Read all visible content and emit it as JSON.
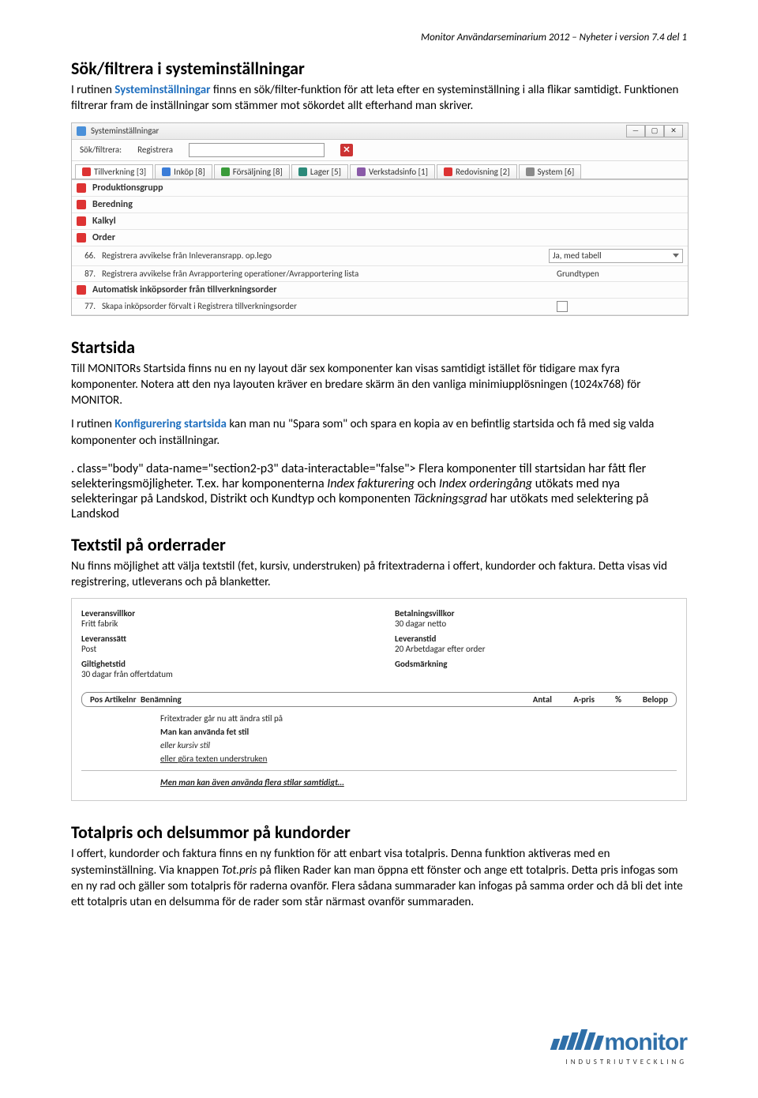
{
  "header": "Monitor Användarseminarium 2012 – Nyheter i version 7.4 del 1",
  "sec1": {
    "title": "Sök/filtrera i systeminställningar",
    "para": "I rutinen Systeminställningar finns en sök/filter-funktion för att leta efter en systeminställning i alla flikar samtidigt. Funktionen filtrerar fram de inställningar som stämmer mot sökordet allt efterhand man skriver.",
    "link_word": "Systeminställningar"
  },
  "ss1": {
    "title": "Systeminställningar",
    "toolbar": {
      "label1": "Sök/filtrera:",
      "label2": "Registrera"
    },
    "tabs": [
      {
        "label": "Tillverkning [3]",
        "cls": "red"
      },
      {
        "label": "Inköp [8]",
        "cls": "blue"
      },
      {
        "label": "Försäljning [8]",
        "cls": "green"
      },
      {
        "label": "Lager [5]",
        "cls": "teal"
      },
      {
        "label": "Verkstadsinfo [1]",
        "cls": "nv"
      },
      {
        "label": "Redovisning [2]",
        "cls": "red"
      },
      {
        "label": "System [6]",
        "cls": "sys"
      }
    ],
    "groups": [
      "Produktionsgrupp",
      "Beredning",
      "Kalkyl",
      "Order"
    ],
    "rows": [
      {
        "num": "66.",
        "label": "Registrera avvikelse från Inleveransrapp. op.lego",
        "value": "Ja, med tabell",
        "type": "select"
      },
      {
        "num": "87.",
        "label": "Registrera avvikelse från Avrapportering operationer/Avrapportering lista",
        "value": "Grundtypen",
        "type": "text"
      }
    ],
    "group2": "Automatisk inköpsorder från tillverkningsorder",
    "row77": {
      "num": "77.",
      "label": "Skapa inköpsorder förvalt i Registrera tillverkningsorder"
    }
  },
  "sec2": {
    "title": "Startsida",
    "p1": "Till MONITORs Startsida finns nu en ny layout där sex komponenter kan visas samtidigt istället för tidigare max fyra komponenter. Notera att den nya layouten kräver en bredare skärm än den vanliga minimiupplösningen (1024x768) för MONITOR.",
    "p2a": "I rutinen ",
    "p2_link": "Konfigurering startsida",
    "p2b": " kan man nu \"Spara som\" och spara en kopia av en befintlig startsida och få med sig valda komponenter och inställningar.",
    "p3a": "Flera komponenter till startsidan har fått fler selekteringsmöjligheter. T.ex. har komponenterna ",
    "p3_i1": "Index fakturering",
    "p3b": " och ",
    "p3_i2": "Index orderingång",
    "p3c": " utökats med nya selekteringar på Landskod, Distrikt och Kundtyp och komponenten ",
    "p3_i3": "Täckningsgrad",
    "p3d": " har utökats med selektering på Landskod"
  },
  "sec3": {
    "title": "Textstil på orderrader",
    "para": "Nu finns möjlighet att välja textstil (fet, kursiv, understruken) på fritextraderna i offert, kundorder och faktura. Detta visas vid registrering, utleverans och på blanketter."
  },
  "ss2": {
    "left": [
      {
        "lbl": "Leveransvillkor",
        "val": "Fritt fabrik"
      },
      {
        "lbl": "Leveranssätt",
        "val": "Post"
      },
      {
        "lbl": "Giltighetstid",
        "val": "30 dagar från offertdatum"
      }
    ],
    "right": [
      {
        "lbl": "Betalningsvillkor",
        "val": "30 dagar netto"
      },
      {
        "lbl": "Leveranstid",
        "val": "20 Arbetdagar efter order"
      },
      {
        "lbl": "Godsmärkning",
        "val": ""
      }
    ],
    "thead": {
      "pos": "Pos Artikelnr",
      "name": "Benämning",
      "antal": "Antal",
      "apris": "A-pris",
      "pct": "%",
      "belopp": "Belopp"
    },
    "rows": [
      {
        "text": "Fritextrader går nu att ändra stil på",
        "style": ""
      },
      {
        "text": "Man kan använda fet stil",
        "style": "bold"
      },
      {
        "text": "eller kursiv stil",
        "style": "italic"
      },
      {
        "text": "eller göra texten understruken",
        "style": "underline"
      },
      {
        "text": "Men man kan även använda flera stilar samtidigt…",
        "style": "bi-u"
      }
    ]
  },
  "sec4": {
    "title": "Totalpris och delsummor på kundorder",
    "p_a": "I offert, kundorder och faktura finns en ny funktion för att enbart visa totalpris. Denna funktion aktiveras med en systeminställning. Via knappen ",
    "p_i": "Tot.pris",
    "p_b": " på fliken Rader kan man öppna ett fönster och ange ett totalpris. Detta pris infogas som en ny rad och gäller som totalpris för raderna ovanför. Flera sådana summarader kan infogas på samma order och då bli det inte ett totalpris utan en delsumma för de rader som står närmast ovanför summaraden."
  },
  "footer": {
    "brand": "monitor",
    "sub": "INDUSTRIUTVECKLING"
  }
}
